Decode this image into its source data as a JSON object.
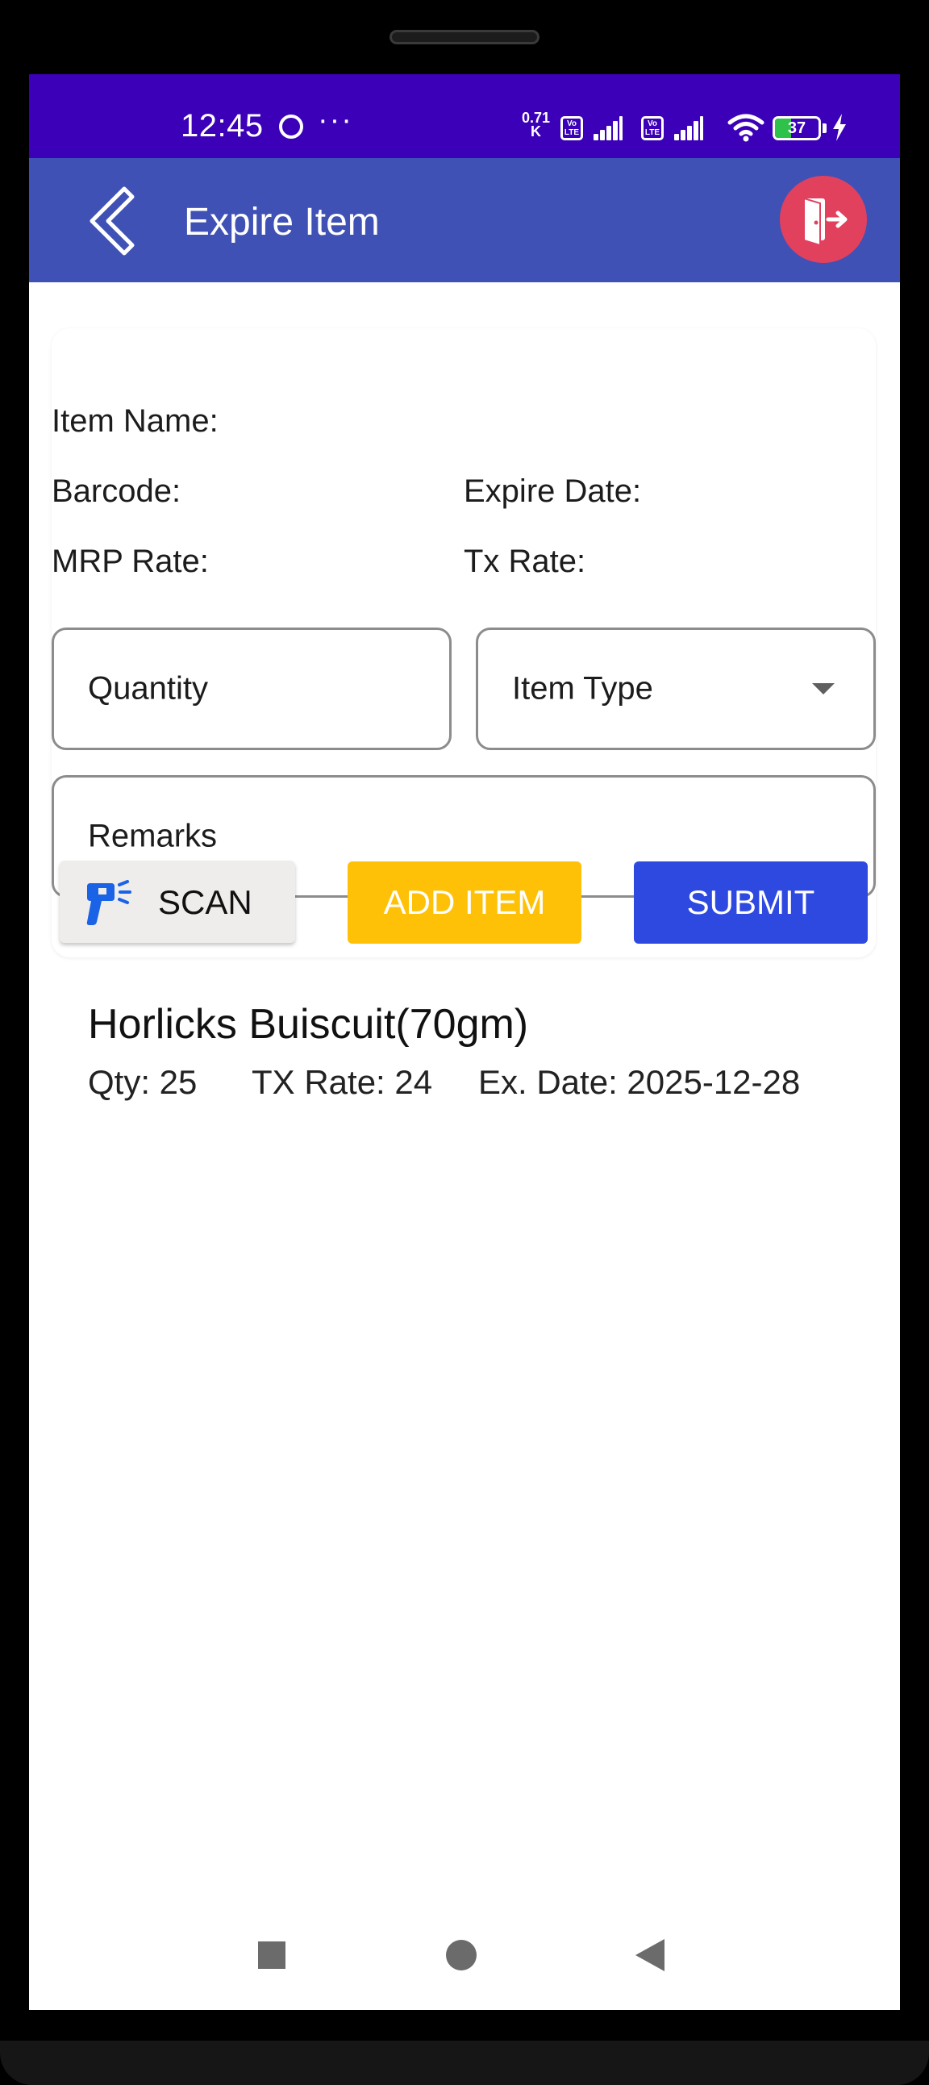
{
  "status_bar": {
    "time": "12:45",
    "more": "···",
    "net_speed_value": "0.71",
    "net_speed_unit": "K",
    "volte_1": "Vo LTE",
    "volte_2": "Vo LTE",
    "battery": "37",
    "battery_level": 0.37
  },
  "app_bar": {
    "title": "Expire Item",
    "color": "#3f51b5",
    "exit_color": "#e2415e"
  },
  "details": {
    "item_name_label": "Item Name:",
    "barcode_label": "Barcode:",
    "expire_date_label": "Expire Date:",
    "mrp_rate_label": "MRP Rate:",
    "tx_rate_label": "Tx Rate:"
  },
  "form": {
    "quantity_placeholder": "Quantity",
    "item_type_placeholder": "Item Type",
    "remarks_placeholder": "Remarks"
  },
  "buttons": {
    "scan": "SCAN",
    "add_item": "ADD ITEM",
    "submit": "SUBMIT",
    "add_color": "#ffc107",
    "submit_color": "#2e49e0"
  },
  "items": [
    {
      "name": "Horlicks Buiscuit(70gm)",
      "qty": "Qty: 25",
      "tx_rate": "TX Rate: 24",
      "ex_date": "Ex. Date: 2025-12-28"
    }
  ]
}
